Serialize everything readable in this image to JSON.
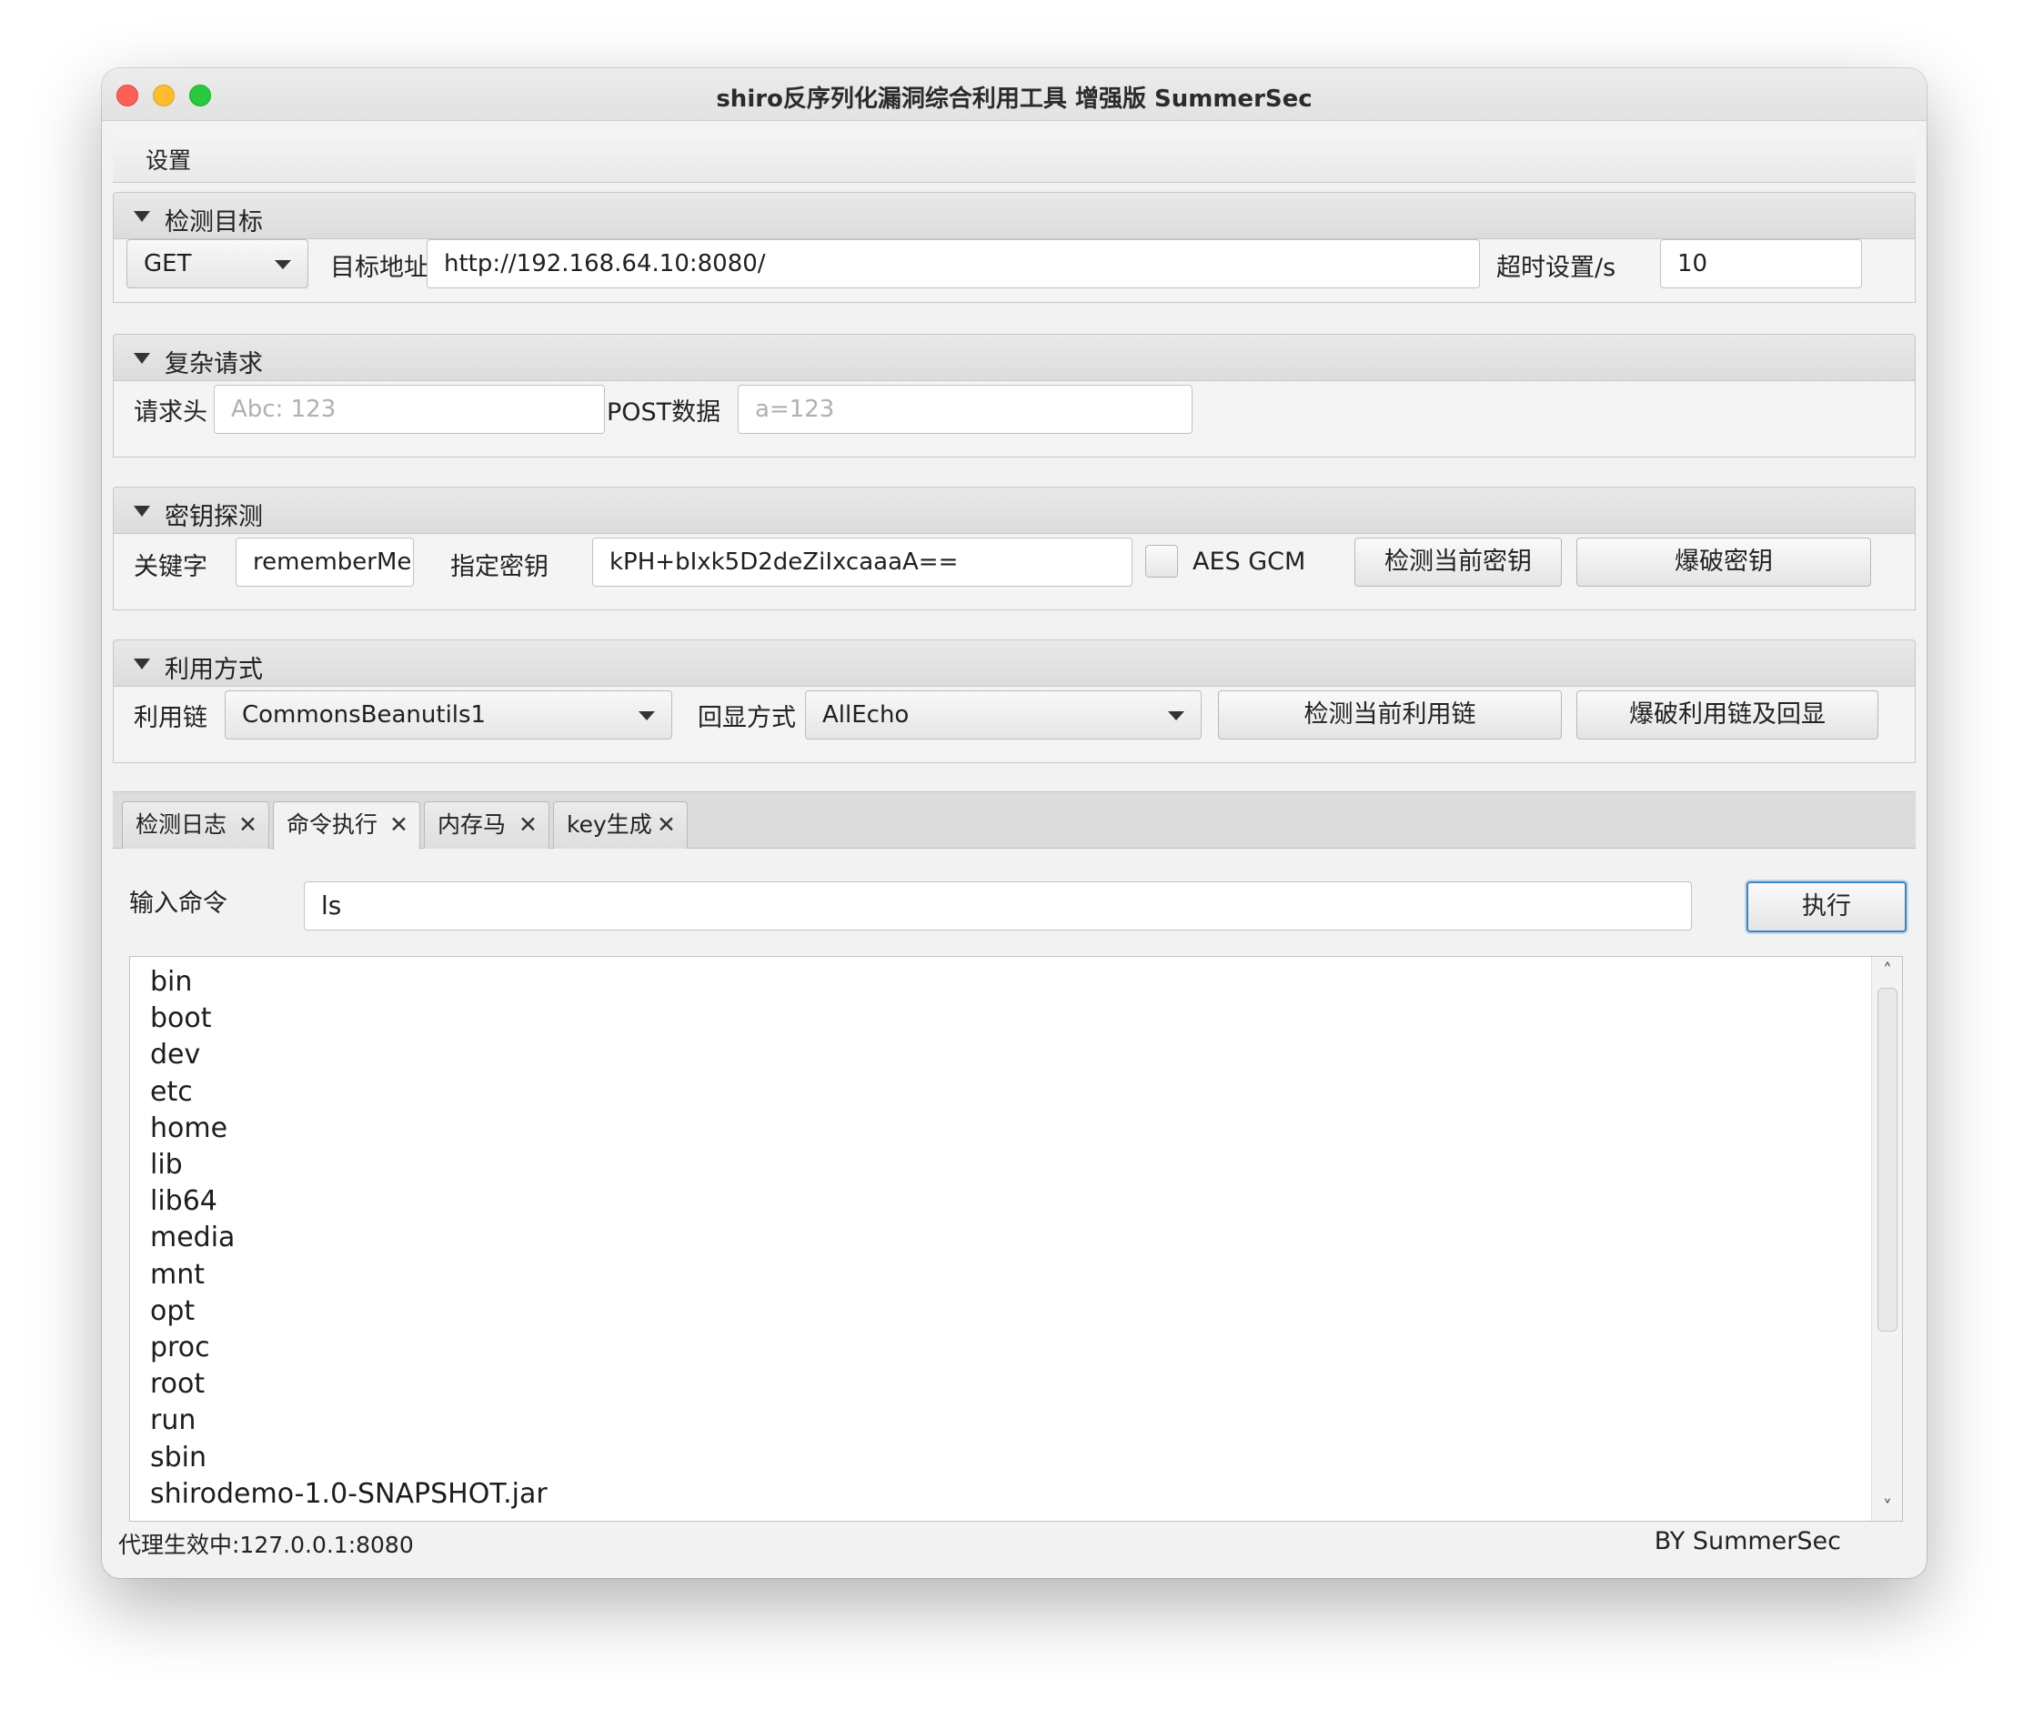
{
  "window": {
    "title": "shiro反序列化漏洞综合利用工具 增强版 SummerSec"
  },
  "menu": {
    "settings": "设置"
  },
  "sections": {
    "target": {
      "title": "检测目标",
      "method": "GET",
      "url_label": "目标地址",
      "url_value": "http://192.168.64.10:8080/",
      "timeout_label": "超时设置/s",
      "timeout_value": "10"
    },
    "complex": {
      "title": "复杂请求",
      "header_label": "请求头",
      "header_placeholder": "Abc: 123",
      "post_label": "POST数据",
      "post_placeholder": "a=123"
    },
    "key": {
      "title": "密钥探测",
      "keyword_label": "关键字",
      "keyword_value": "rememberMe",
      "key_label": "指定密钥",
      "key_value": "kPH+bIxk5D2deZiIxcaaaA==",
      "aes_gcm_label": "AES GCM",
      "aes_gcm_checked": false,
      "detect_button": "检测当前密钥",
      "brute_button": "爆破密钥"
    },
    "exploit": {
      "title": "利用方式",
      "chain_label": "利用链",
      "chain_value": "CommonsBeanutils1",
      "echo_label": "回显方式",
      "echo_value": "AllEcho",
      "detect_button": "检测当前利用链",
      "brute_button": "爆破利用链及回显"
    }
  },
  "tabs": [
    {
      "label": "检测日志",
      "close": "✕"
    },
    {
      "label": "命令执行",
      "close": "✕",
      "active": true
    },
    {
      "label": "内存马",
      "close": "✕"
    },
    {
      "label": "key生成",
      "close": "✕"
    }
  ],
  "command": {
    "label": "输入命令",
    "value": "ls",
    "execute_button": "执行",
    "output": [
      "bin",
      "boot",
      "dev",
      "etc",
      "home",
      "lib",
      "lib64",
      "media",
      "mnt",
      "opt",
      "proc",
      "root",
      "run",
      "sbin",
      "shirodemo-1.0-SNAPSHOT.jar"
    ]
  },
  "status": {
    "proxy": "代理生效中:127.0.0.1:8080",
    "author": "BY  SummerSec"
  },
  "icons": {
    "scroll_up": "˄",
    "scroll_down": "˅"
  },
  "colors": {
    "close": "#fe5f57",
    "minimize": "#febc2e",
    "maximize": "#28c840",
    "focus": "#3d84c6"
  }
}
